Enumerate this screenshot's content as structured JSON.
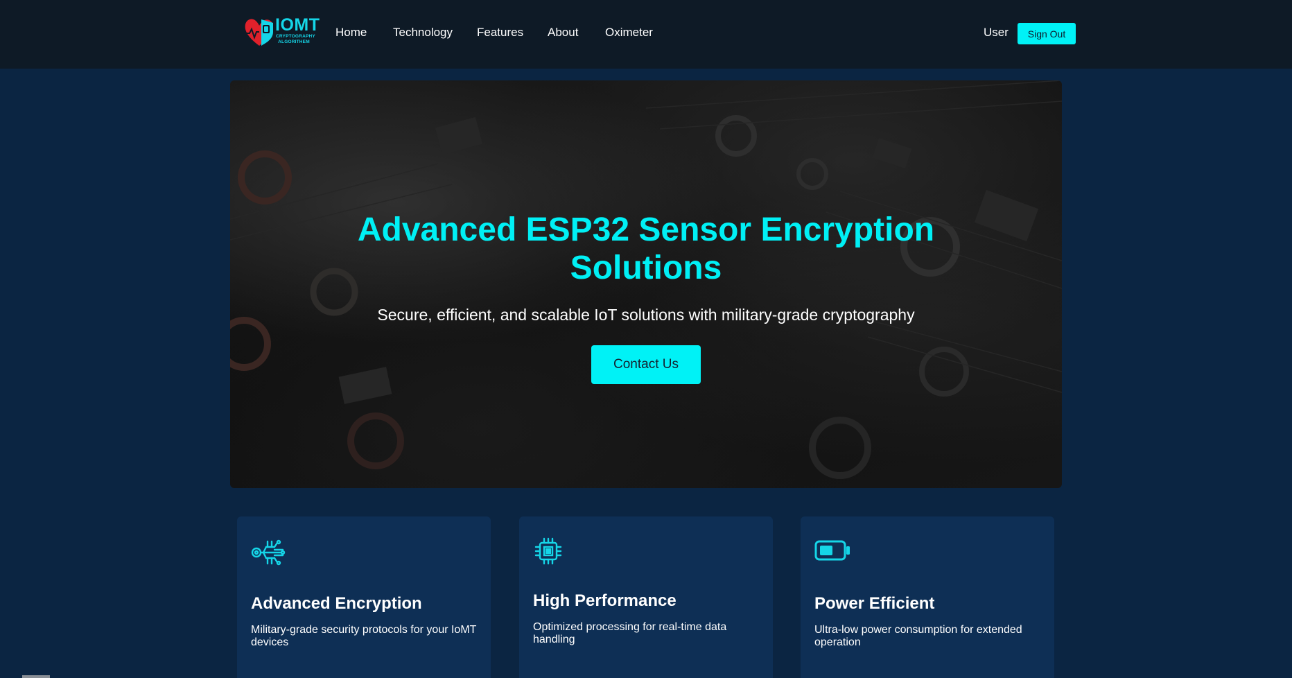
{
  "brand": {
    "logo_title": "IOMT",
    "logo_subtitle_line1": "CRYPTOGRAPHY",
    "logo_subtitle_line2": "ALGORITHEM"
  },
  "nav": {
    "links": [
      "Home",
      "Technology",
      "Features",
      "About",
      "Oximeter"
    ],
    "user_label": "User",
    "signout_label": "Sign Out"
  },
  "hero": {
    "title_line1": "Advanced ESP32 Sensor Encryption",
    "title_line2": "Solutions",
    "subtitle": "Secure, efficient, and scalable IoT solutions with military-grade cryptography",
    "cta_label": "Contact Us"
  },
  "features": [
    {
      "icon": "circuit-encryption-icon",
      "title": "Advanced Encryption",
      "description": "Military-grade security protocols for your IoMT devices"
    },
    {
      "icon": "chip-icon",
      "title": "High Performance",
      "description": "Optimized processing for real-time data handling"
    },
    {
      "icon": "battery-icon",
      "title": "Power Efficient",
      "description": "Ultra-low power consumption for extended operation"
    }
  ],
  "colors": {
    "accent": "#00f2f6",
    "background": "#0b2542",
    "navbar": "#0e1a26",
    "card": "#0e2f55",
    "logo_heart": "#e0212b"
  }
}
